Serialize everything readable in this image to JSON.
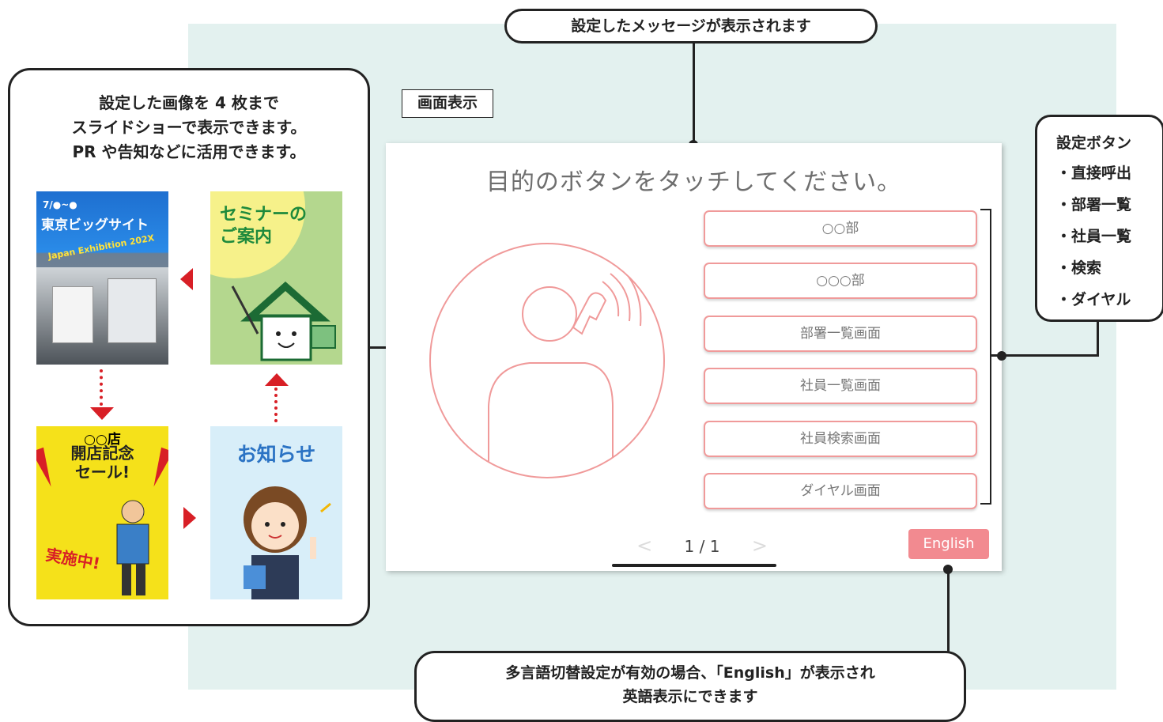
{
  "top_callout": "設定したメッセージが表示されます",
  "label_box": "画面表示",
  "left_panel": {
    "title_lines": [
      "設定した画像を 4 枚まで",
      "スライドショーで表示できます。",
      "PR や告知などに活用できます。"
    ],
    "slides": {
      "expo": {
        "date": "7/●~●",
        "venue": "東京ビッグサイト",
        "event": "Japan Exhibition 202X"
      },
      "seminar": {
        "line1": "セミナーの",
        "line2": "ご案内"
      },
      "sale": {
        "store": "○○店",
        "line1": "開店記念",
        "line2": "セール!",
        "badge": "実施中!"
      },
      "notice": {
        "title": "お知らせ"
      }
    }
  },
  "screen": {
    "message": "目的のボタンをタッチしてください。",
    "buttons": [
      "○○部",
      "○○○部",
      "部署一覧画面",
      "社員一覧画面",
      "社員検索画面",
      "ダイヤル画面"
    ],
    "pager": {
      "prev": "<",
      "text": "1 / 1",
      "next": ">"
    },
    "english_button": "English"
  },
  "right_callout": {
    "title": "設定ボタン",
    "items": [
      "・直接呼出",
      "・部署一覧",
      "・社員一覧",
      "・検索",
      "・ダイヤル"
    ]
  },
  "bottom_callout": {
    "line1": "多言語切替設定が有効の場合、「English」が表示され",
    "line2": "英語表示にできます"
  },
  "colors": {
    "accent_red": "#d81f26",
    "button_border": "#f09a9a",
    "english_bg": "#f28a90",
    "panel_bg": "#e3f1ef"
  }
}
